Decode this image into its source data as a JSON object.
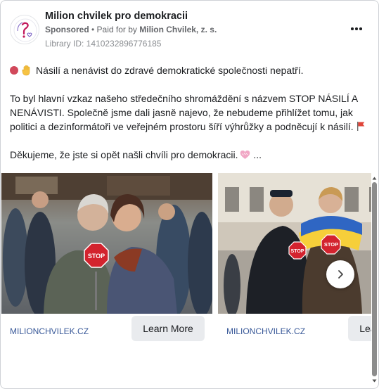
{
  "header": {
    "advertiser": "Milion chvilek pro demokracii",
    "sponsored": "Sponsored",
    "separator": " • ",
    "paid_prefix": "Paid for by ",
    "payer": "Milion Chvilek, z. s.",
    "library_id": "Library ID: 1410232896776185",
    "more_icon": "more-horizontal-icon"
  },
  "body": {
    "p1": "Násilí a nenávist do zdravé demokratické společnosti nepatří.",
    "p2": "To byl hlavní vzkaz našeho středečního shromáždění s názvem STOP NÁSILÍ A NENÁVISTI. Společně jsme dali jasně najevo, že nebudeme přihlížet tomu, jak politici a dezinformátoři ve veřejném prostoru šíří výhrůžky a podněcují k násilí.",
    "p3": "Děkujeme, že jste si opět našli chvíli pro demokracii.",
    "see_more": " ...",
    "icons": [
      "red-circle-icon",
      "raised-hand-icon",
      "red-flag-icon",
      "heart-icon"
    ]
  },
  "carousel": {
    "cards": [
      {
        "link": "MILIONCHVILEK.CZ",
        "cta": "Learn More",
        "image": "two-women-holding-stop-sign-photo"
      },
      {
        "link": "MILIONCHVILEK.CZ",
        "cta": "Learn More",
        "image": "young-men-holding-stop-signs-photo"
      }
    ],
    "next_icon": "chevron-right-icon"
  },
  "colors": {
    "link": "#385898",
    "cta_bg": "#e9ebee",
    "brand": "#c2185b"
  }
}
